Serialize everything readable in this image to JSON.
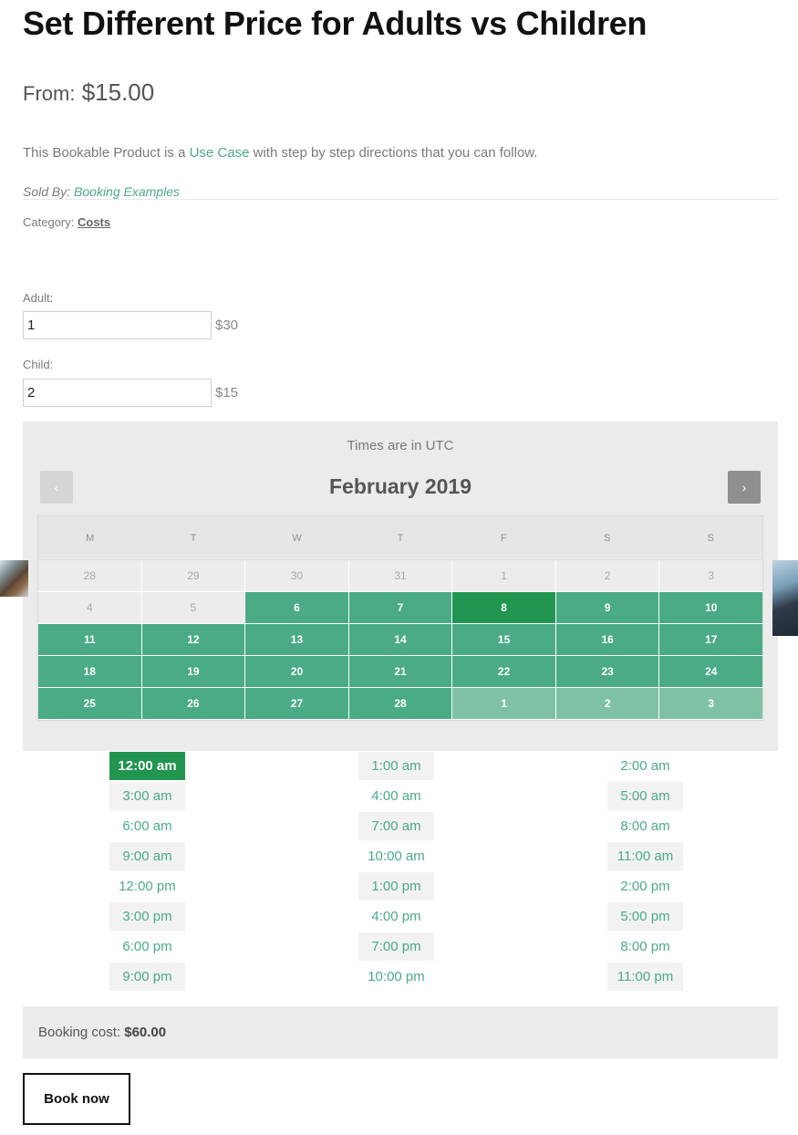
{
  "product": {
    "title": "Set Different Price for Adults vs Children",
    "price_prefix": "From:",
    "price": "$15.00",
    "description_before": "This Bookable Product is a ",
    "description_link": "Use Case",
    "description_after": " with step by step directions that you can follow.",
    "sold_by_label": "Sold By:",
    "sold_by_link": "Booking Examples",
    "category_label": "Category:",
    "category_link": "Costs"
  },
  "persons": {
    "adult_label": "Adult:",
    "adult_value": "1",
    "adult_price": "$30",
    "child_label": "Child:",
    "child_value": "2",
    "child_price": "$15"
  },
  "calendar": {
    "timezone_note": "Times are in UTC",
    "month_label": "February 2019",
    "prev_glyph": "‹",
    "next_glyph": "›",
    "weekdays": [
      "M",
      "T",
      "W",
      "T",
      "F",
      "S",
      "S"
    ],
    "weeks": [
      [
        {
          "d": "28",
          "s": "disabled"
        },
        {
          "d": "29",
          "s": "disabled"
        },
        {
          "d": "30",
          "s": "disabled"
        },
        {
          "d": "31",
          "s": "disabled"
        },
        {
          "d": "1",
          "s": "disabled"
        },
        {
          "d": "2",
          "s": "disabled"
        },
        {
          "d": "3",
          "s": "disabled"
        }
      ],
      [
        {
          "d": "4",
          "s": "disabled"
        },
        {
          "d": "5",
          "s": "disabled"
        },
        {
          "d": "6",
          "s": "avail"
        },
        {
          "d": "7",
          "s": "avail"
        },
        {
          "d": "8",
          "s": "selected"
        },
        {
          "d": "9",
          "s": "avail"
        },
        {
          "d": "10",
          "s": "avail"
        }
      ],
      [
        {
          "d": "11",
          "s": "avail"
        },
        {
          "d": "12",
          "s": "avail"
        },
        {
          "d": "13",
          "s": "avail"
        },
        {
          "d": "14",
          "s": "avail"
        },
        {
          "d": "15",
          "s": "avail"
        },
        {
          "d": "16",
          "s": "avail"
        },
        {
          "d": "17",
          "s": "avail"
        }
      ],
      [
        {
          "d": "18",
          "s": "avail"
        },
        {
          "d": "19",
          "s": "avail"
        },
        {
          "d": "20",
          "s": "avail"
        },
        {
          "d": "21",
          "s": "avail"
        },
        {
          "d": "22",
          "s": "avail"
        },
        {
          "d": "23",
          "s": "avail"
        },
        {
          "d": "24",
          "s": "avail"
        }
      ],
      [
        {
          "d": "25",
          "s": "avail"
        },
        {
          "d": "26",
          "s": "avail"
        },
        {
          "d": "27",
          "s": "avail"
        },
        {
          "d": "28",
          "s": "avail"
        },
        {
          "d": "1",
          "s": "next-month"
        },
        {
          "d": "2",
          "s": "next-month"
        },
        {
          "d": "3",
          "s": "next-month"
        }
      ]
    ]
  },
  "time_slots": [
    {
      "label": "12:00 am",
      "selected": true
    },
    {
      "label": "1:00 am"
    },
    {
      "label": "2:00 am"
    },
    {
      "label": "3:00 am"
    },
    {
      "label": "4:00 am"
    },
    {
      "label": "5:00 am"
    },
    {
      "label": "6:00 am"
    },
    {
      "label": "7:00 am"
    },
    {
      "label": "8:00 am"
    },
    {
      "label": "9:00 am"
    },
    {
      "label": "10:00 am"
    },
    {
      "label": "11:00 am"
    },
    {
      "label": "12:00 pm"
    },
    {
      "label": "1:00 pm"
    },
    {
      "label": "2:00 pm"
    },
    {
      "label": "3:00 pm"
    },
    {
      "label": "4:00 pm"
    },
    {
      "label": "5:00 pm"
    },
    {
      "label": "6:00 pm"
    },
    {
      "label": "7:00 pm"
    },
    {
      "label": "8:00 pm"
    },
    {
      "label": "9:00 pm"
    },
    {
      "label": "10:00 pm"
    },
    {
      "label": "11:00 pm"
    }
  ],
  "booking": {
    "cost_label": "Booking cost:",
    "cost_value": "$60.00",
    "book_button": "Book now"
  },
  "colors": {
    "accent": "#4aab85",
    "selected": "#229651",
    "next_month": "#7ec1a5"
  }
}
